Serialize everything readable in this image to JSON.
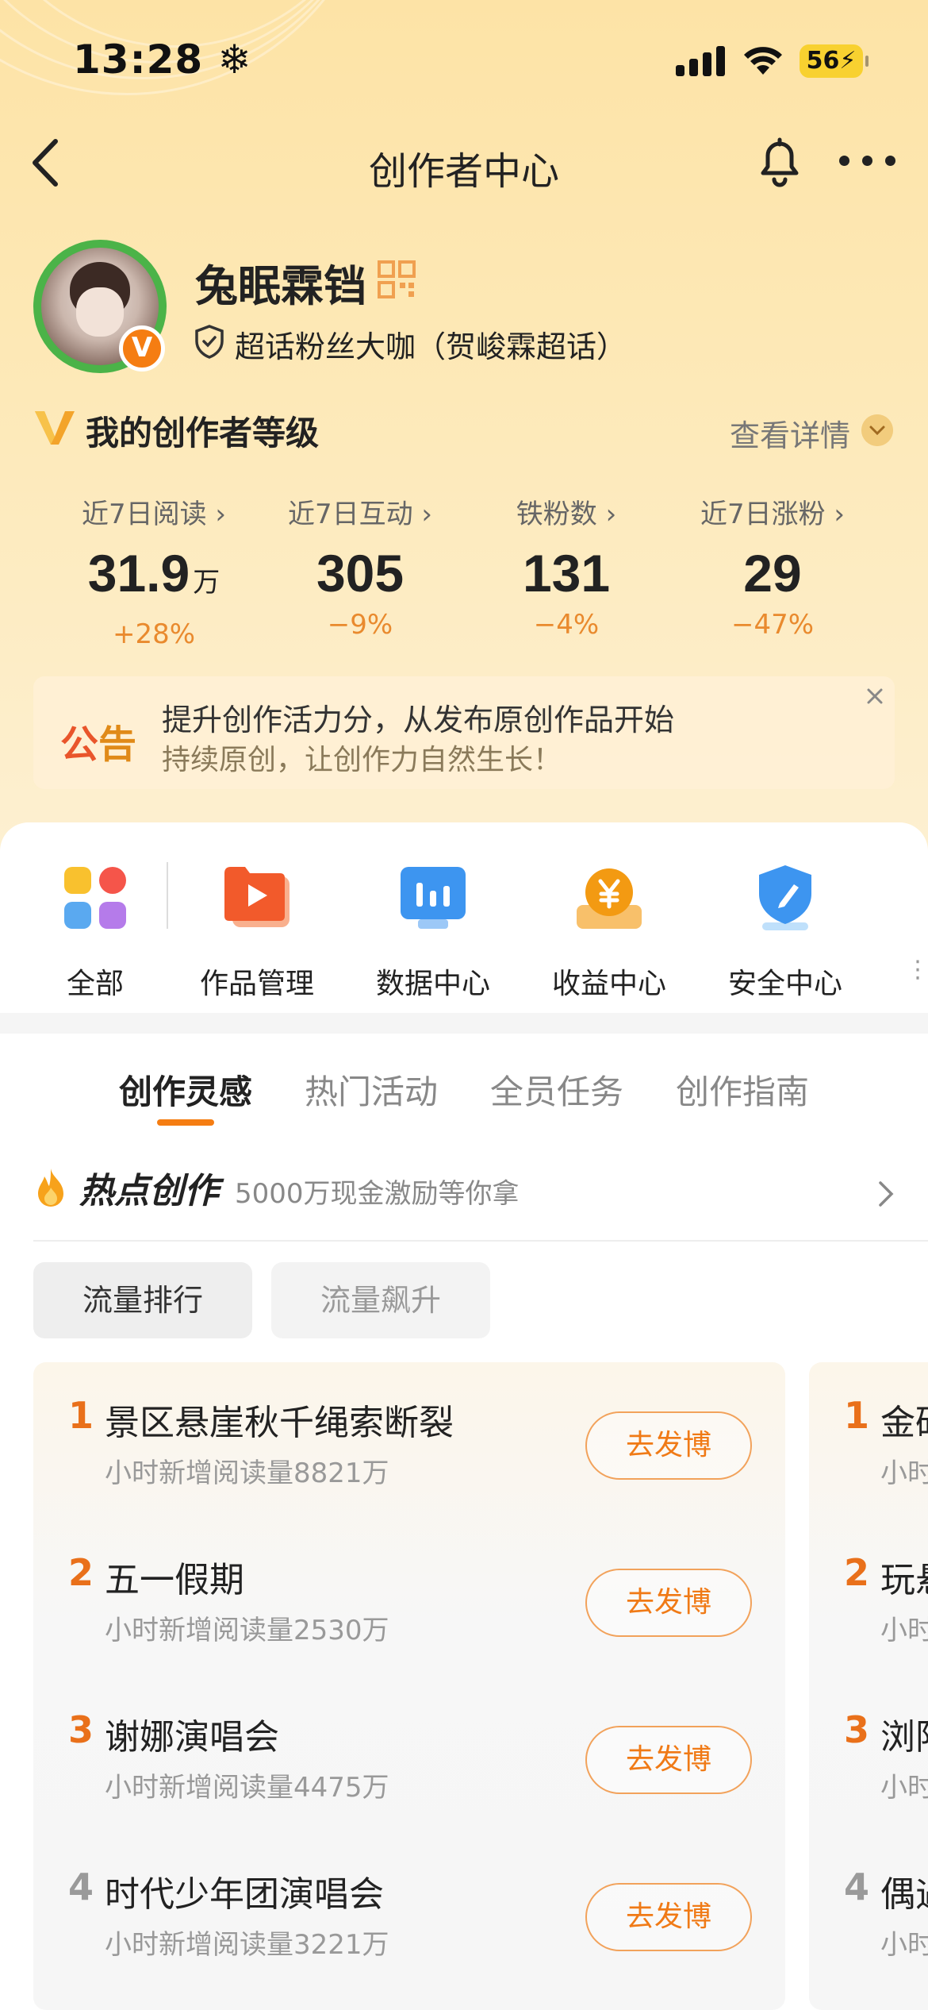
{
  "status_bar": {
    "time": "13:28 ❄",
    "battery": "56"
  },
  "nav": {
    "title": "创作者中心"
  },
  "profile": {
    "username": "兔眠霖铛",
    "fan_title": "超话粉丝大咖（贺峻霖超话）",
    "badge": "V"
  },
  "level": {
    "title": "我的创作者等级",
    "detail_label": "查看详情"
  },
  "stats": [
    {
      "label": "近7日阅读 ›",
      "value": "31.9",
      "unit": "万",
      "change": "+28%"
    },
    {
      "label": "近7日互动 ›",
      "value": "305",
      "unit": "",
      "change": "−9%"
    },
    {
      "label": "铁粉数 ›",
      "value": "131",
      "unit": "",
      "change": "−4%"
    },
    {
      "label": "近7日涨粉 ›",
      "value": "29",
      "unit": "",
      "change": "−47%"
    }
  ],
  "notice": {
    "tag_a": "公",
    "tag_b": "告",
    "line1": "提升创作活力分，从发布原创作品开始",
    "line2": "持续原创，让创作力自然生长！"
  },
  "quick_menu": [
    {
      "label": "全部",
      "icon": "grid-apps-icon"
    },
    {
      "label": "作品管理",
      "icon": "play-video-icon"
    },
    {
      "label": "数据中心",
      "icon": "bar-chart-icon"
    },
    {
      "label": "收益中心",
      "icon": "coin-yuan-icon"
    },
    {
      "label": "安全中心",
      "icon": "shield-pen-icon"
    }
  ],
  "tabs": [
    "创作灵感",
    "热门活动",
    "全员任务",
    "创作指南"
  ],
  "hot": {
    "title": "热点创作",
    "subtitle": "5000万现金激励等你拿"
  },
  "filters": [
    "流量排行",
    "流量飙升"
  ],
  "ranks": [
    {
      "num": "1",
      "title": "景区悬崖秋千绳索断裂",
      "sub": "小时新增阅读量8821万",
      "btn": "去发博"
    },
    {
      "num": "2",
      "title": "五一假期",
      "sub": "小时新增阅读量2530万",
      "btn": "去发博"
    },
    {
      "num": "3",
      "title": "谢娜演唱会",
      "sub": "小时新增阅读量4475万",
      "btn": "去发博"
    },
    {
      "num": "4",
      "title": "时代少年团演唱会",
      "sub": "小时新增阅读量3221万",
      "btn": "去发博"
    }
  ],
  "ranks_peek": [
    {
      "num": "1",
      "title": "金矿",
      "sub": "小时"
    },
    {
      "num": "2",
      "title": "玩悬",
      "sub": "小时"
    },
    {
      "num": "3",
      "title": "浏阳",
      "sub": "小时"
    },
    {
      "num": "4",
      "title": "偶遇",
      "sub": "小时"
    }
  ],
  "colors": {
    "accent": "#f57d12",
    "rank_top": "#e9701a",
    "rank_other": "#9a9a9a",
    "header_bg": "#fde3a6"
  }
}
